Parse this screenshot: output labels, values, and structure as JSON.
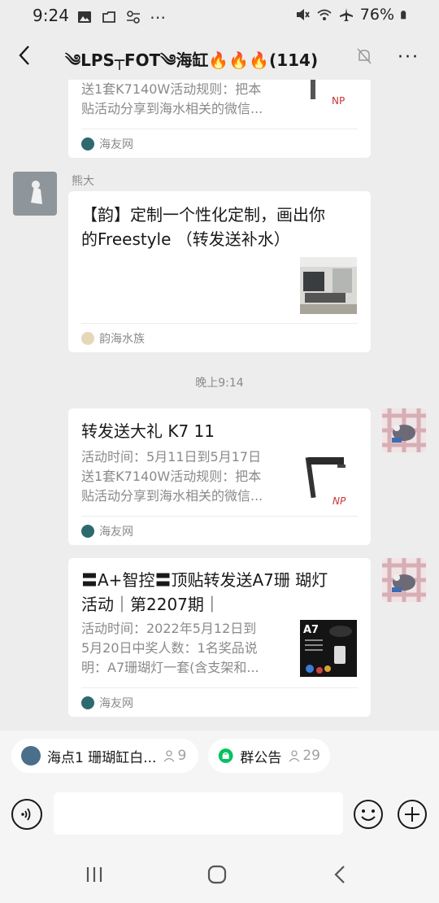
{
  "status_bar": {
    "time": "9:24",
    "dots": "⋯",
    "battery": "76%"
  },
  "header": {
    "title": "༄LPS┬FOT༄海缸🔥🔥🔥(114)",
    "more": "···"
  },
  "time_separator": "晚上9:14",
  "messages": [
    {
      "desc_line1": "送1套K7140W活动规则：把本",
      "desc_line2": "贴活动分享到海水相关的微信...",
      "source": "海友网"
    },
    {
      "sender": "熊大",
      "title_line1": "【韵】定制一个性化定制，画出你",
      "title_line2": "的Freestyle （转发送补水）",
      "source": "韵海水族"
    },
    {
      "title": "转发送大礼 K7 11",
      "desc_line1": "活动时间：5月11日到5月17日",
      "desc_line2": "送1套K7140W活动规则：把本",
      "desc_line3": "贴活动分享到海水相关的微信...",
      "thumb_text": "NP",
      "source": "海友网"
    },
    {
      "title_line1": "〓A+智控〓顶贴转发送A7珊 瑚灯",
      "title_line2": "活动｜第2207期｜",
      "desc_line1": "活动时间：2022年5月12日到",
      "desc_line2": "5月20日中奖人数：1名奖品说",
      "desc_line3": "明：A7珊瑚灯一套(含支架和...",
      "thumb_text": "A7",
      "source": "海友网"
    }
  ],
  "chips": [
    {
      "label": "海点1 珊瑚缸白...",
      "count": "9"
    },
    {
      "label": "群公告",
      "count": "29"
    }
  ],
  "colors": {
    "background": "#ededed",
    "card": "#ffffff",
    "muted_text": "#8a8a8a",
    "wechat_green": "#07c160"
  }
}
